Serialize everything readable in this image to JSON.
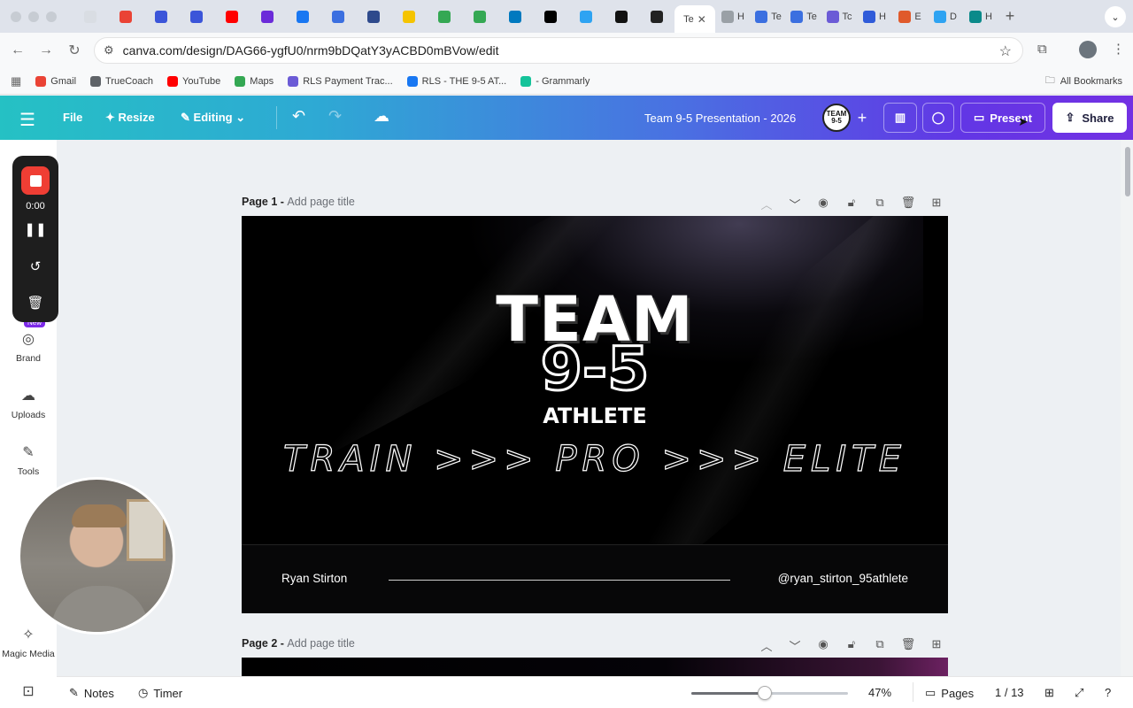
{
  "browser": {
    "tabs": [
      {
        "fav": "#d9dde3",
        "label": ""
      },
      {
        "fav": "#ea4335",
        "label": ""
      },
      {
        "fav": "#3b55d9",
        "label": ""
      },
      {
        "fav": "#3b55d9",
        "label": ""
      },
      {
        "fav": "#ff0000",
        "label": ""
      },
      {
        "fav": "#6b2bd9",
        "label": ""
      },
      {
        "fav": "#1877f2",
        "label": ""
      },
      {
        "fav": "#3b6fe0",
        "label": ""
      },
      {
        "fav": "#2e4a8c",
        "label": ""
      },
      {
        "fav": "#f5c400",
        "label": ""
      },
      {
        "fav": "#34a853",
        "label": ""
      },
      {
        "fav": "#34a853",
        "label": ""
      },
      {
        "fav": "#0079bf",
        "label": ""
      },
      {
        "fav": "#000000",
        "label": ""
      },
      {
        "fav": "#2ea3f2",
        "label": ""
      },
      {
        "fav": "#111111",
        "label": ""
      },
      {
        "fav": "#222222",
        "label": ""
      }
    ],
    "active_tab_label": "Te",
    "tabs_after": [
      {
        "fav": "#9aa0a6",
        "label": "H"
      },
      {
        "fav": "#3b6fe0",
        "label": "Te"
      },
      {
        "fav": "#3b6fe0",
        "label": "Te"
      },
      {
        "fav": "#6b5bd6",
        "label": "Tc"
      },
      {
        "fav": "#2f5bd9",
        "label": "H"
      },
      {
        "fav": "#e05a2b",
        "label": "E"
      },
      {
        "fav": "#2ea3f2",
        "label": "D"
      },
      {
        "fav": "#0b8a8a",
        "label": "H"
      }
    ],
    "url": "canva.com/design/DAG66-ygfU0/nrm9bDQatY3yACBD0mBVow/edit",
    "bookmarks": [
      {
        "label": "Gmail",
        "color": "#ea4335"
      },
      {
        "label": "TrueCoach",
        "color": "#5f6368"
      },
      {
        "label": "YouTube",
        "color": "#ff0000"
      },
      {
        "label": "Maps",
        "color": "#34a853"
      },
      {
        "label": "RLS Payment Trac...",
        "color": "#6b5bd6"
      },
      {
        "label": "RLS - THE 9-5 AT...",
        "color": "#1877f2"
      },
      {
        "label": "- Grammarly",
        "color": "#15c39a"
      }
    ],
    "all_bookmarks": "All Bookmarks"
  },
  "canva": {
    "menu_file": "File",
    "menu_resize": "Resize",
    "menu_editing": "Editing",
    "doc_title": "Team 9-5 Presentation - 2026",
    "avatar_text": "TEAM 9-5",
    "present": "Present",
    "share": "Share"
  },
  "rail": [
    {
      "label": "Brand",
      "icon": "brand-icon"
    },
    {
      "label": "Uploads",
      "icon": "uploads-icon"
    },
    {
      "label": "Tools",
      "icon": "tools-icon"
    },
    {
      "label": "Magic Media",
      "icon": "magic-media-icon"
    }
  ],
  "rail_badge": "New",
  "recorder": {
    "time": "0:00"
  },
  "pages": [
    {
      "label": "Page 1 - ",
      "placeholder": "Add page title"
    },
    {
      "label": "Page 2 - ",
      "placeholder": "Add page title"
    }
  ],
  "slide": {
    "team": "TEAM",
    "number": "9-5",
    "athlete": "ATHLETE",
    "tagline": "TRAIN >>> PRO >>> ELITE",
    "presenter": "Ryan Stirton",
    "handle": "@ryan_stirton_95athlete"
  },
  "bottom": {
    "notes": "Notes",
    "timer": "Timer",
    "zoom": "47%",
    "zoom_level": 0.47,
    "pages": "Pages",
    "page_counter": "1 / 13"
  }
}
